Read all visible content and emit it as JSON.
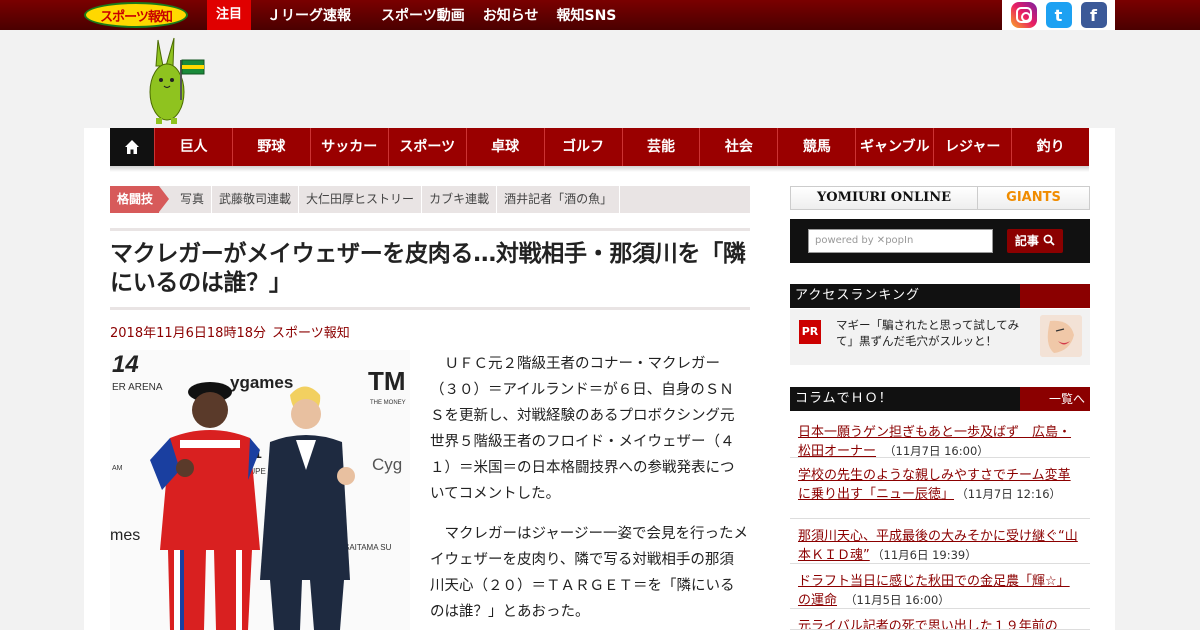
{
  "brand": {
    "logo_text": "スポーツ報知"
  },
  "topnav": {
    "hot_label": "注目",
    "items": [
      "Ｊリーグ速報",
      "スポーツ動画",
      "お知らせ",
      "報知SNS"
    ]
  },
  "social": {
    "twitter_glyph": "t",
    "facebook_glyph": "f"
  },
  "mainnav": {
    "categories": [
      "巨人",
      "野球",
      "サッカー",
      "スポーツ",
      "卓球",
      "ゴルフ",
      "芸能",
      "社会",
      "競馬",
      "ギャンブル",
      "レジャー",
      "釣り"
    ]
  },
  "breadcrumb": {
    "category": "格闘技",
    "links": [
      "写真",
      "武藤敬司連載",
      "大仁田厚ヒストリー",
      "カブキ連載",
      "酒井記者「酒の魚」"
    ]
  },
  "article": {
    "title": "マクレガーがメイウェザーを皮肉る…対戦相手・那須川を「隣にいるのは誰？」",
    "date": "2018年11月6日18時18分",
    "source": "スポーツ報知",
    "paragraphs": [
      "ＵＦＣ元２階級王者のコナー・マクレガー（３０）＝アイルランド＝が６日、自身のＳＮＳを更新し、対戦経験のあるプロボクシング元世界５階級王者のフロイド・メイウェザー（４１）＝米国＝の日本格闘技界への参戦発表についてコメントした。",
      "マクレガーはジャージー一姿で会見を行ったメイウェザーを皮肉り、隣で写る対戦相手の那須川天心（２０）＝ＴＡＲＧＥＴ＝を「隣にいるのは誰？」とあおった。"
    ]
  },
  "sidebar": {
    "partners": {
      "yomiuri": "YOMIURI ONLINE",
      "giants": "GIANTS"
    },
    "search": {
      "placeholder": "powered by ✕popIn",
      "button": "記事"
    },
    "ranking": {
      "title": "アクセスランキング",
      "pr_label": "PR",
      "pr_text": "マギー「騙されたと思って試してみて」黒ずんだ毛穴がスルッと！"
    },
    "column": {
      "title": "コラムでＨＯ！",
      "more": "一覧へ",
      "items": [
        {
          "title": "日本一願うゲン担ぎもあと一歩及ばず　広島・松田オーナー",
          "date": "（11月7日 16:00）"
        },
        {
          "title": "学校の先生のような親しみやすさでチーム変革に乗り出す「ニュー辰徳」",
          "date": "（11月7日 12:16）"
        },
        {
          "title": "那須川天心、平成最後の大みそかに受け継ぐ“山本ＫＩＤ魂”",
          "date": "（11月6日 19:39）"
        },
        {
          "title": "ドラフト当日に感じた秋田での金足農「輝☆」の運命",
          "date": "（11月5日 16:00）"
        },
        {
          "title": "元ライバル記者の死で思い出した１９年前の",
          "date": ""
        }
      ]
    }
  },
  "photo": {
    "backdrop_texts": [
      "14",
      "ER ARENA",
      "ygames",
      "TM",
      "THE MONEY",
      "Cyg",
      "N.1",
      "SUPE",
      "AM",
      "mes",
      "SAITAMA SU"
    ]
  }
}
